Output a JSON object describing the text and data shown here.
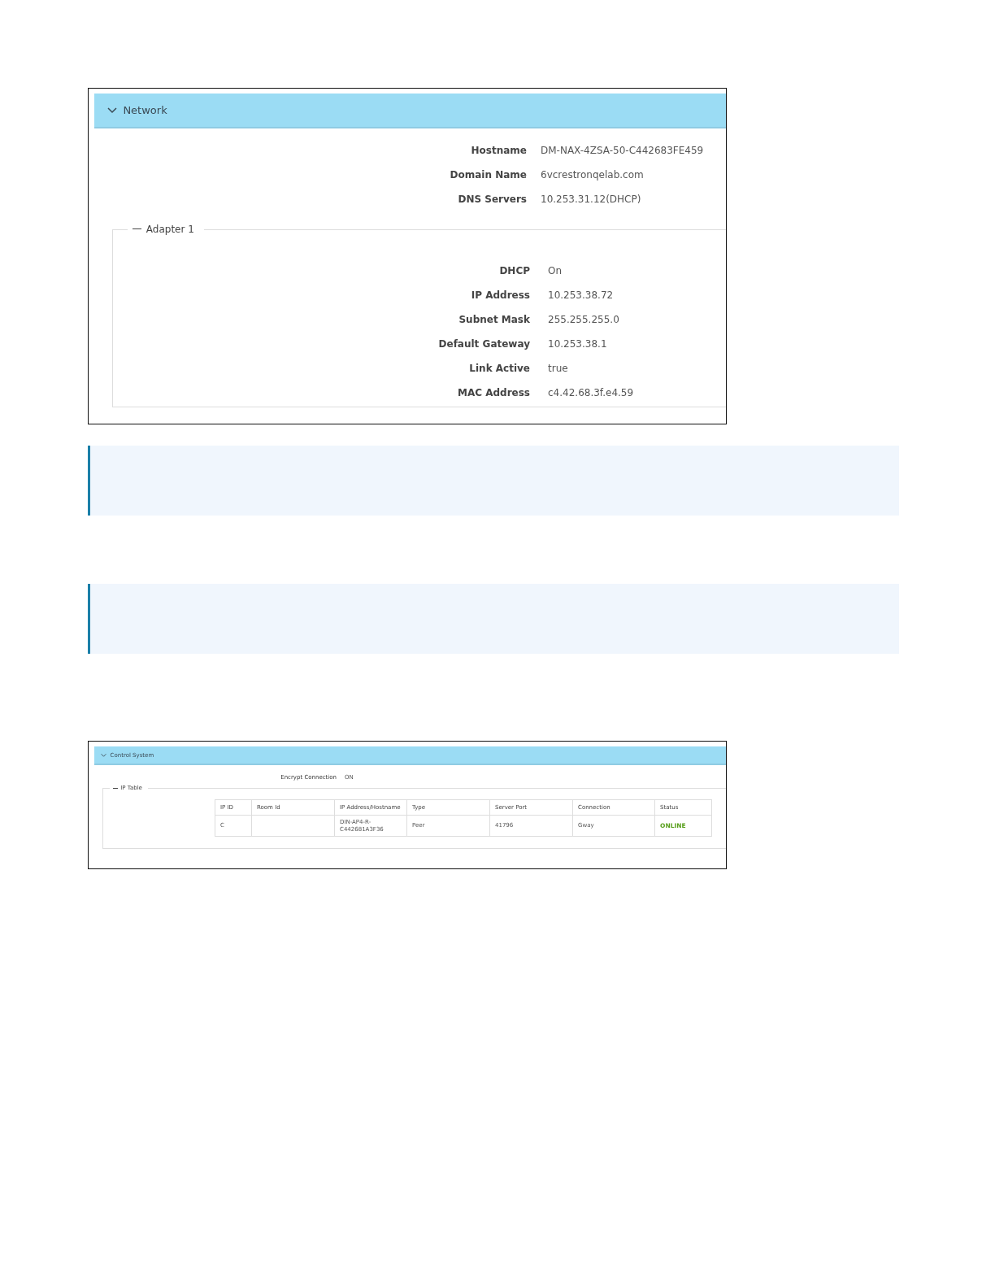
{
  "network_panel": {
    "title": "Network",
    "expanded": true,
    "fields": [
      {
        "label": "Hostname",
        "value": "DM-NAX-4ZSA-50-C442683FE459"
      },
      {
        "label": "Domain Name",
        "value": "6vcrestronqelab.com"
      },
      {
        "label": "DNS Servers",
        "value": "10.253.31.12(DHCP)"
      }
    ],
    "adapter": {
      "title": "Adapter 1",
      "expanded": true,
      "fields": [
        {
          "label": "DHCP",
          "value": "On"
        },
        {
          "label": "IP Address",
          "value": "10.253.38.72"
        },
        {
          "label": "Subnet Mask",
          "value": "255.255.255.0"
        },
        {
          "label": "Default Gateway",
          "value": "10.253.38.1"
        },
        {
          "label": "Link Active",
          "value": "true"
        },
        {
          "label": "MAC Address",
          "value": "c4.42.68.3f.e4.59"
        }
      ]
    }
  },
  "note_boxes": [
    {
      "kind": "note"
    },
    {
      "kind": "note"
    }
  ],
  "control_system_panel": {
    "title": "Control System",
    "expanded": true,
    "fields": [
      {
        "label": "Encrypt Connection",
        "value": "ON"
      }
    ],
    "ip_table": {
      "title": "IP Table",
      "expanded": true,
      "columns": [
        "IP ID",
        "Room Id",
        "IP Address/Hostname",
        "Type",
        "Server Port",
        "Connection",
        "Status"
      ],
      "rows": [
        {
          "cells": [
            "C",
            "",
            "DIN-AP4-R-C442681A3F36",
            "Peer",
            "41796",
            "Gway",
            "ONLINE"
          ],
          "color": "#5aa01e"
        }
      ]
    }
  }
}
